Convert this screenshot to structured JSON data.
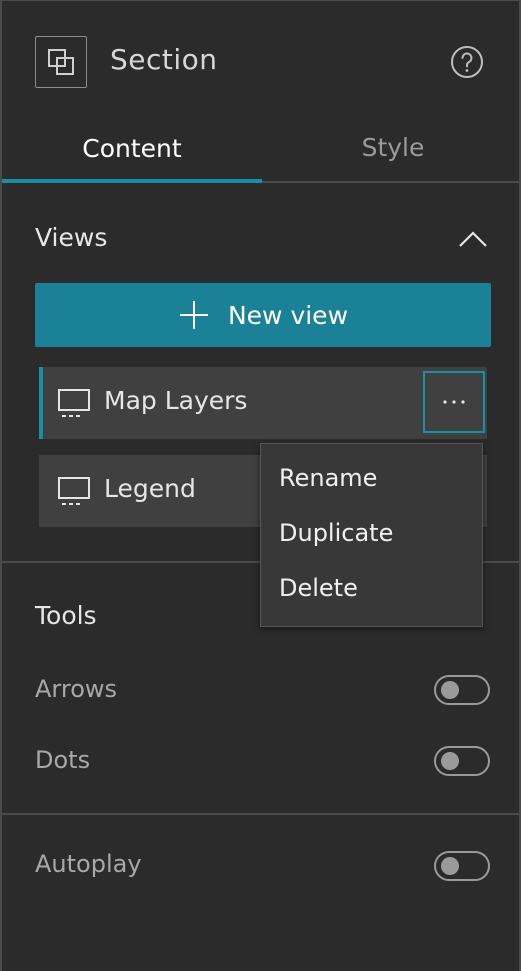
{
  "header": {
    "title": "Section",
    "icon": "section-icon",
    "help_icon": "help-icon"
  },
  "tabs": [
    {
      "label": "Content",
      "active": true
    },
    {
      "label": "Style",
      "active": false
    }
  ],
  "views": {
    "title": "Views",
    "collapse_icon": "chevron-up-icon",
    "new_view_label": "New view",
    "items": [
      {
        "label": "Map Layers",
        "icon": "monitor-icon",
        "selected": true
      },
      {
        "label": "Legend",
        "icon": "monitor-icon",
        "selected": false
      }
    ]
  },
  "context_menu": {
    "items": [
      "Rename",
      "Duplicate",
      "Delete"
    ]
  },
  "tools": {
    "title": "Tools",
    "options": [
      {
        "label": "Arrows",
        "enabled": false
      },
      {
        "label": "Dots",
        "enabled": false
      }
    ]
  },
  "autoplay": {
    "label": "Autoplay",
    "enabled": false
  },
  "colors": {
    "accent": "#1a8fa3",
    "button_bg": "#1a8196",
    "panel_bg": "#2b2b2b",
    "item_bg": "#404040"
  }
}
